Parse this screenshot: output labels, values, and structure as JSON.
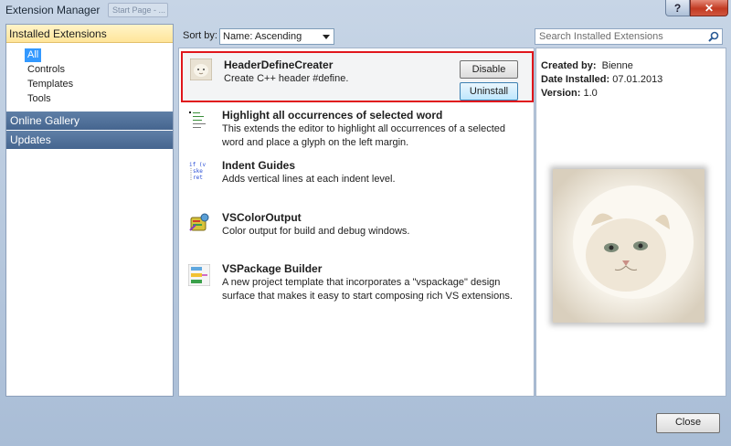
{
  "window": {
    "title": "Extension Manager",
    "ghost_tab": "Start Page - ..."
  },
  "titlebar": {
    "help_label": "?",
    "close_label": "✕"
  },
  "sidebar": {
    "header": "Installed Extensions",
    "items": [
      {
        "label": "All",
        "selected": true
      },
      {
        "label": "Controls"
      },
      {
        "label": "Templates"
      },
      {
        "label": "Tools"
      }
    ],
    "sections": [
      "Online Gallery",
      "Updates"
    ]
  },
  "sort": {
    "label": "Sort by:",
    "value": "Name: Ascending"
  },
  "search": {
    "placeholder": "Search Installed Extensions"
  },
  "extensions": [
    {
      "name": "HeaderDefineCreater",
      "description": "Create C++  header #define.",
      "icon": "cat-thumbnail-icon",
      "selected": true,
      "disable_label": "Disable",
      "uninstall_label": "Uninstall"
    },
    {
      "name": "Highlight all occurrences of selected word",
      "description": "This extends the editor to highlight all occurrences of a selected word and place a glyph on the left margin.",
      "icon": "highlight-code-icon"
    },
    {
      "name": "Indent Guides",
      "description": "Adds vertical lines at each indent level.",
      "icon": "indent-code-icon"
    },
    {
      "name": "VSColorOutput",
      "description": "Color output for build and debug windows.",
      "icon": "color-output-icon"
    },
    {
      "name": "VSPackage Builder",
      "description": "A new project template that incorporates a \"vspackage\" design surface that makes it easy to start composing rich VS extensions.",
      "icon": "package-builder-icon"
    }
  ],
  "details": {
    "created_by_label": "Created by:",
    "created_by": "Bienne",
    "date_label": "Date Installed:",
    "date": "07.01.2013",
    "version_label": "Version:",
    "version": "1.0"
  },
  "footer": {
    "close_label": "Close"
  },
  "colors": {
    "selection_border": "#e0161c",
    "sidebar_section": "#4f6f99",
    "header_highlight": "#ffe59a"
  }
}
